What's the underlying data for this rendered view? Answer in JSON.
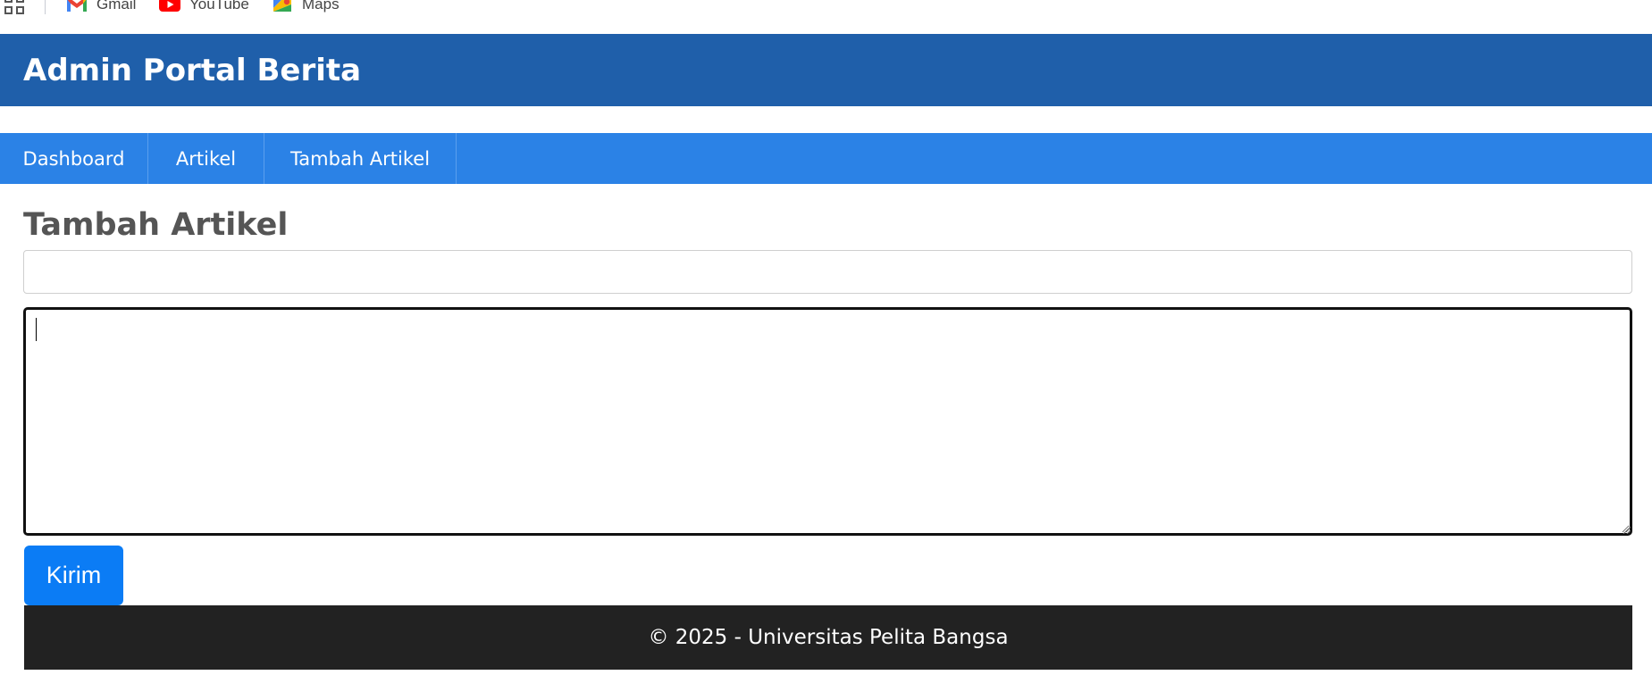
{
  "bookmarks": [
    {
      "label": "Gmail",
      "icon": "gmail-icon"
    },
    {
      "label": "YouTube",
      "icon": "youtube-icon"
    },
    {
      "label": "Maps",
      "icon": "maps-icon"
    }
  ],
  "header": {
    "title": "Admin Portal Berita"
  },
  "nav": {
    "items": [
      {
        "label": "Dashboard"
      },
      {
        "label": "Artikel"
      },
      {
        "label": "Tambah Artikel"
      }
    ]
  },
  "main": {
    "heading": "Tambah Artikel",
    "title_input": {
      "value": "",
      "placeholder": ""
    },
    "content_textarea": {
      "value": "",
      "placeholder": ""
    },
    "submit_label": "Kirim"
  },
  "footer": {
    "text": "© 2025 - Universitas Pelita Bangsa"
  },
  "colors": {
    "header_bg": "#1f5faa",
    "nav_bg": "#2b82e6",
    "button_bg": "#0b7cf5",
    "footer_bg": "#222222",
    "heading_text": "#555555"
  }
}
